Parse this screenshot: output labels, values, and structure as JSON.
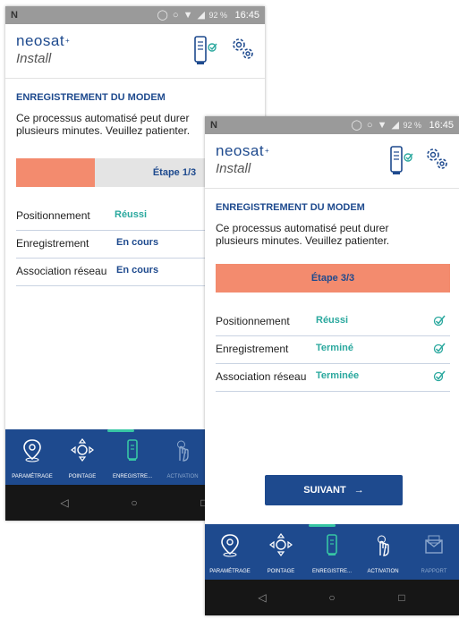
{
  "status_bar": {
    "time": "16:45",
    "battery": "92 %"
  },
  "brand": {
    "name": "neosat",
    "subtitle": "Install"
  },
  "colors": {
    "brand_blue": "#1e4a8e",
    "teal": "#2aa89e",
    "step_orange": "#f38b6e",
    "step_gray": "#e4e4e4",
    "nav_active": "#37c6a4"
  },
  "back_screen": {
    "title": "ENREGISTREMENT DU MODEM",
    "description": [
      "Ce processus automatisé peut durer",
      "plusieurs minutes. Veuillez patienter."
    ],
    "step": {
      "label": "Étape 1/3",
      "progress": 0.33
    },
    "rows": [
      {
        "label": "Positionnement",
        "status": "Réussi"
      },
      {
        "label": "Enregistrement",
        "status": "En cours"
      },
      {
        "label": "Association réseau",
        "status": "En cours"
      }
    ],
    "nav": [
      "PARAMÉTRAGE",
      "POINTAGE",
      "ENREGISTRE...",
      "ACTIVATION"
    ]
  },
  "front_screen": {
    "title": "ENREGISTREMENT DU MODEM",
    "description": [
      "Ce processus automatisé peut durer",
      "plusieurs minutes. Veuillez patienter."
    ],
    "step": {
      "label": "Étape 3/3",
      "progress": 1.0
    },
    "rows": [
      {
        "label": "Positionnement",
        "status": "Réussi"
      },
      {
        "label": "Enregistrement",
        "status": "Terminé"
      },
      {
        "label": "Association réseau",
        "status": "Terminée"
      }
    ],
    "button": {
      "label": "SUIVANT",
      "arrow": "→"
    },
    "nav": [
      "PARAMÉTRAGE",
      "POINTAGE",
      "ENREGISTRE...",
      "ACTIVATION",
      "RAPPORT"
    ]
  },
  "icons": {
    "header": [
      "modem-check-icon",
      "gears-icon"
    ],
    "nav": [
      "location-pin-icon",
      "pointing-arrows-icon",
      "modem-icon",
      "hand-tap-icon",
      "report-envelope-icon"
    ],
    "android": [
      "back-triangle-icon",
      "home-circle-icon",
      "recents-square-icon"
    ]
  }
}
